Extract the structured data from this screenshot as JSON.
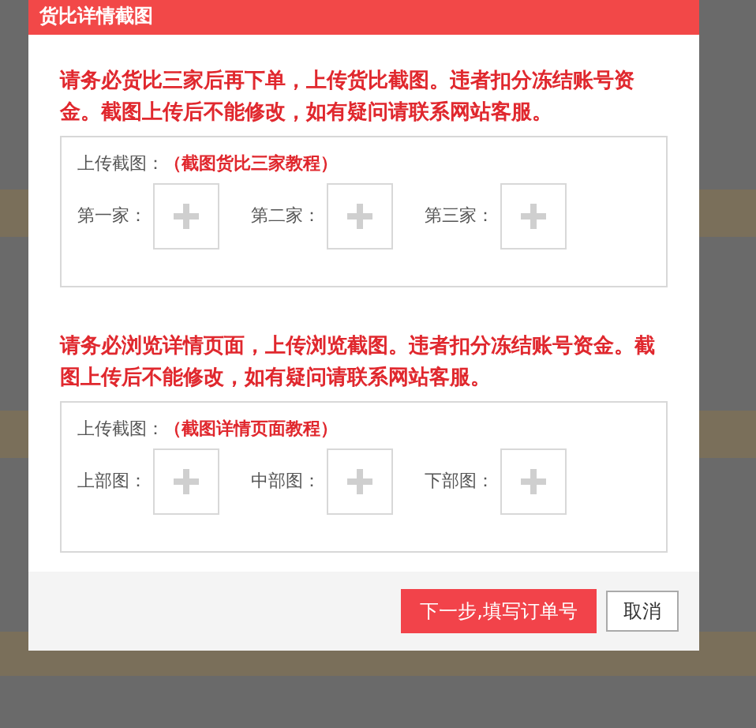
{
  "dialog": {
    "title": "货比详情截图"
  },
  "sections": [
    {
      "notice": "请务必货比三家后再下单，上传货比截图。违者扣分冻结账号资金。截图上传后不能修改，如有疑问请联系网站客服。",
      "upload_label": "上传截图：",
      "tutorial_link": "（截图货比三家教程）",
      "slots": [
        {
          "label": "第一家："
        },
        {
          "label": "第二家："
        },
        {
          "label": "第三家："
        }
      ]
    },
    {
      "notice": "请务必浏览详情页面，上传浏览截图。违者扣分冻结账号资金。截图上传后不能修改，如有疑问请联系网站客服。",
      "upload_label": "上传截图：",
      "tutorial_link": "（截图详情页面教程）",
      "slots": [
        {
          "label": "上部图："
        },
        {
          "label": "中部图："
        },
        {
          "label": "下部图："
        }
      ]
    }
  ],
  "buttons": [
    {
      "label": "下一步,填写订单号",
      "kind": "primary"
    },
    {
      "label": "取消",
      "kind": "default"
    }
  ]
}
